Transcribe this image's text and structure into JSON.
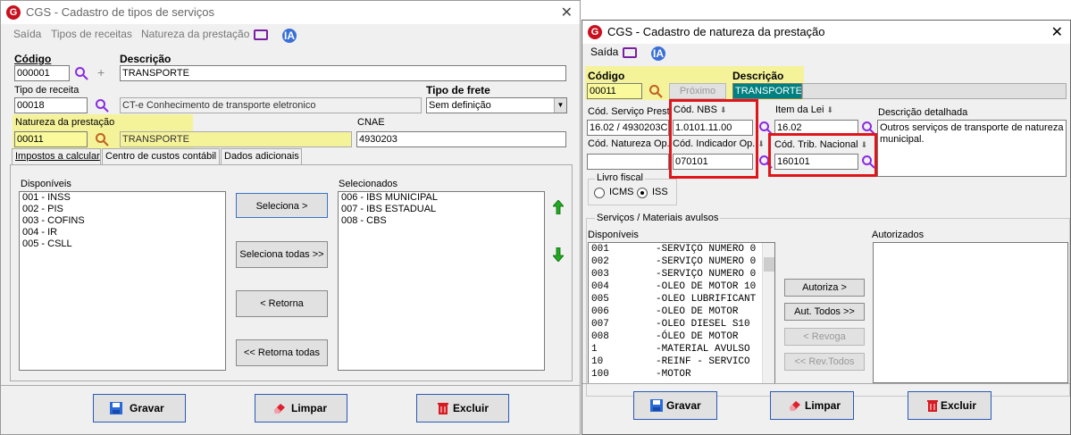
{
  "window1": {
    "title": "CGS - Cadastro de tipos de serviços",
    "menu": [
      "Saída",
      "Tipos de receitas",
      "Natureza da prestação"
    ],
    "ia_label": "IA",
    "codigo_label": "Código",
    "codigo_value": "000001",
    "descricao_label": "Descrição",
    "descricao_value": "TRANSPORTE",
    "tipo_receita_label": "Tipo de receita",
    "tipo_receita_code": "00018",
    "tipo_receita_desc": "CT-e Conhecimento de transporte eletronico",
    "tipo_frete_label": "Tipo de frete",
    "tipo_frete_value": "Sem definição",
    "natureza_label": "Natureza da prestação",
    "natureza_code": "00011",
    "natureza_desc": "TRANSPORTE",
    "cnae_label": "CNAE",
    "cnae_value": "4930203",
    "tabs": [
      "Impostos a calcular",
      "Centro de custos contábil",
      "Dados adicionais"
    ],
    "disponiveis_label": "Disponíveis",
    "disponiveis": [
      "001 - INSS",
      "002 - PIS",
      "003 - COFINS",
      "004 - IR",
      "005 - CSLL"
    ],
    "selecionados_label": "Selecionados",
    "selecionados": [
      "006 - IBS MUNICIPAL",
      "007 - IBS ESTADUAL",
      "008 - CBS"
    ],
    "btn_seleciona": "Seleciona >",
    "btn_seleciona_todas": "Seleciona todas >>",
    "btn_retorna": "< Retorna",
    "btn_retorna_todas": "<< Retorna todas",
    "btn_gravar": "Gravar",
    "btn_limpar": "Limpar",
    "btn_excluir": "Excluir"
  },
  "window2": {
    "title": "CGS - Cadastro de natureza da prestação",
    "menu": [
      "Saída"
    ],
    "ia_label": "IA",
    "codigo_label": "Código",
    "codigo_value": "00011",
    "proximo_label": "Próximo",
    "descricao_label": "Descrição",
    "descricao_value": "TRANSPORTE",
    "cod_servico_label": "Cód. Serviço Prest.",
    "cod_servico_value": "16.02 / 4930203C",
    "cod_nbs_label": "Cód. NBS",
    "cod_nbs_value": "1.0101.11.00",
    "item_lei_label": "Item da Lei",
    "item_lei_value": "16.02",
    "desc_detalhada_label": "Descrição detalhada",
    "desc_detalhada_value": "Outros serviços de transporte de natureza municipal.",
    "cod_natureza_op_label": "Cód. Natureza Op.",
    "cod_indicador_label": "Cód. Indicador Op.",
    "cod_indicador_value": "070101",
    "cod_trib_label": "Cód. Trib. Nacional",
    "cod_trib_value": "160101",
    "livro_fiscal_label": "Livro fiscal",
    "radio_icms": "ICMS",
    "radio_iss": "ISS",
    "servicos_label": "Serviços  /  Materiais avulsos",
    "disponiveis_label": "Disponíveis",
    "autorizados_label": "Autorizados",
    "disponiveis": [
      {
        "code": "001",
        "desc": "-SERVIÇO NUMERO 0"
      },
      {
        "code": "002",
        "desc": "-SERVIÇO NUMERO 0"
      },
      {
        "code": "003",
        "desc": "-SERVIÇO NUMERO 0"
      },
      {
        "code": "004",
        "desc": "-OLEO DE MOTOR 10"
      },
      {
        "code": "005",
        "desc": "-OLEO LUBRIFICANT"
      },
      {
        "code": "006",
        "desc": "-OLEO DE MOTOR"
      },
      {
        "code": "007",
        "desc": "-OLEO DIESEL S10"
      },
      {
        "code": "008",
        "desc": "-ÓLEO DE MOTOR"
      },
      {
        "code": "1",
        "desc": "-MATERIAL AVULSO"
      },
      {
        "code": "10",
        "desc": "-REINF - SERVICO"
      },
      {
        "code": "100",
        "desc": "-MOTOR"
      }
    ],
    "btn_autoriza": "Autoriza >",
    "btn_aut_todos": "Aut. Todos >>",
    "btn_revoga": "< Revoga",
    "btn_rev_todos": "<< Rev.Todos",
    "btn_gravar": "Gravar",
    "btn_limpar": "Limpar",
    "btn_excluir": "Excluir"
  }
}
